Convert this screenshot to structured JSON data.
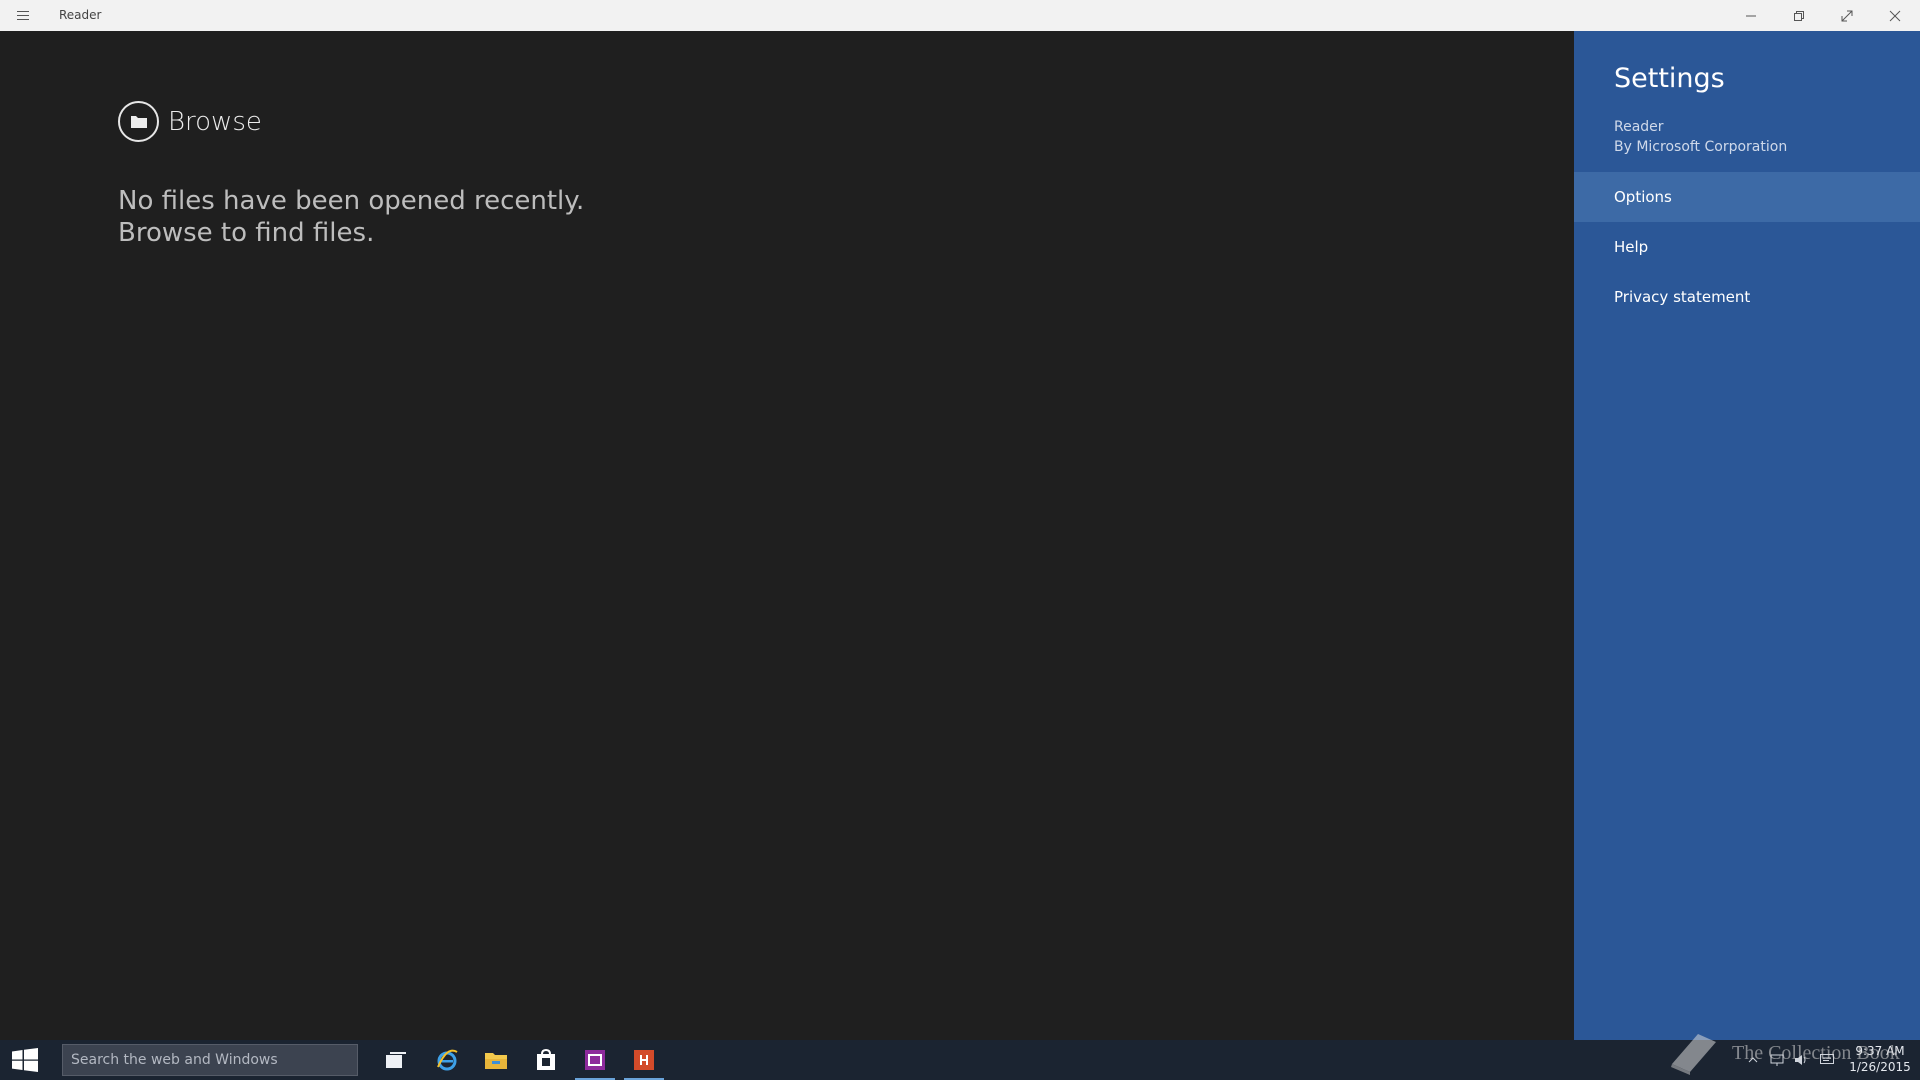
{
  "window": {
    "title": "Reader",
    "menu_icon": "hamburger-icon",
    "controls": [
      "minimize-icon",
      "restore-icon",
      "fullscreen-icon",
      "close-icon"
    ]
  },
  "main": {
    "browse_label": "Browse",
    "browse_icon": "folder-icon",
    "empty_line1": "No files have been opened recently.",
    "empty_line2": "Browse to find files."
  },
  "settings": {
    "title": "Settings",
    "app_name": "Reader",
    "publisher": "By Microsoft Corporation",
    "items": [
      {
        "label": "Options",
        "active": true
      },
      {
        "label": "Help",
        "active": false
      },
      {
        "label": "Privacy statement",
        "active": false
      }
    ],
    "background": "#2b5797"
  },
  "taskbar": {
    "search_placeholder": "Search the web and Windows",
    "apps": [
      "task-view-icon",
      "internet-explorer-icon",
      "file-explorer-icon",
      "store-icon",
      "onenote-icon",
      "reader-icon"
    ],
    "tray_icons": [
      "chevron-up-icon",
      "network-icon",
      "volume-icon",
      "action-center-icon"
    ],
    "time": "9:37 AM",
    "date": "1/26/2015"
  },
  "watermark": {
    "text": "The Collection Book"
  }
}
